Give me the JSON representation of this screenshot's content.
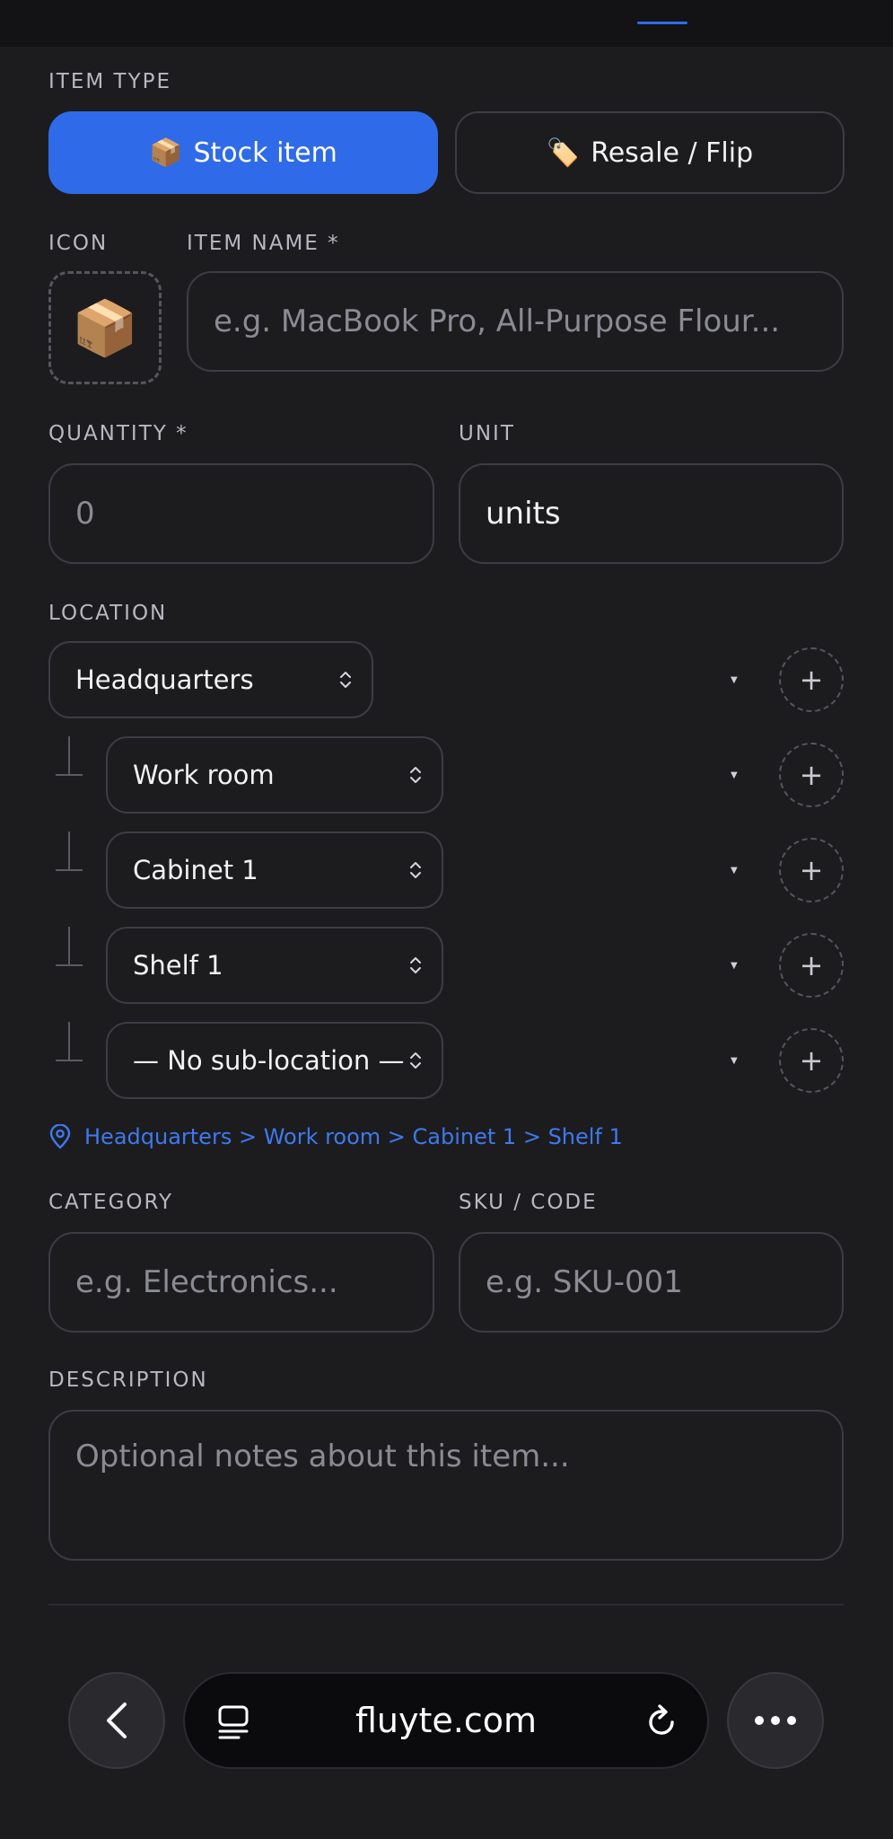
{
  "form": {
    "item_type_label": "ITEM TYPE",
    "item_types": [
      {
        "emoji": "📦",
        "label": "Stock item",
        "selected": true
      },
      {
        "emoji": "🏷️",
        "label": "Resale / Flip",
        "selected": false
      }
    ],
    "icon_label": "ICON",
    "icon_emoji": "📦",
    "item_name_label": "ITEM NAME *",
    "item_name_placeholder": "e.g. MacBook Pro, All-Purpose Flour...",
    "quantity_label": "QUANTITY *",
    "quantity_placeholder": "0",
    "unit_label": "UNIT",
    "unit_value": "units",
    "location_label": "LOCATION",
    "locations": [
      {
        "value": "Headquarters"
      },
      {
        "value": "Work room"
      },
      {
        "value": "Cabinet 1"
      },
      {
        "value": "Shelf 1"
      },
      {
        "value": "— No sub-location —"
      }
    ],
    "location_path": "Headquarters > Work room > Cabinet 1 > Shelf 1",
    "category_label": "CATEGORY",
    "category_placeholder": "e.g. Electronics...",
    "sku_label": "SKU / CODE",
    "sku_placeholder": "e.g. SKU-001",
    "description_label": "DESCRIPTION",
    "description_placeholder": "Optional notes about this item..."
  },
  "browser": {
    "url": "fluyte.com",
    "icons": [
      "back-icon",
      "tab-overview-icon",
      "reload-icon",
      "more-icon"
    ]
  },
  "colors": {
    "accent": "#2f6be8",
    "background": "#1c1c1f",
    "border": "#3c3d44",
    "link": "#3f79ec"
  }
}
